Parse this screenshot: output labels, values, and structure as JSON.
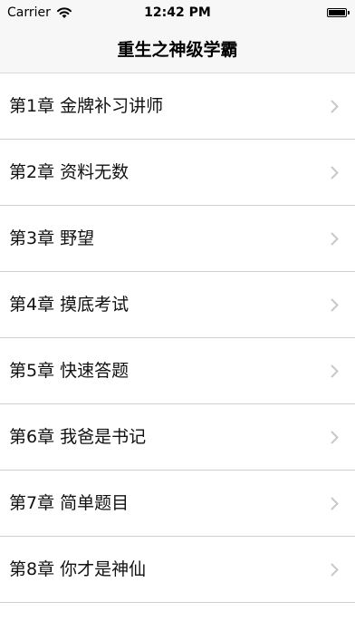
{
  "status_bar": {
    "carrier": "Carrier",
    "time": "12:42 PM"
  },
  "nav": {
    "title": "重生之神级学霸"
  },
  "chapters": [
    "第1章 金牌补习讲师",
    "第2章 资料无数",
    "第3章 野望",
    "第4章 摸底考试",
    "第5章 快速答题",
    "第6章 我爸是书记",
    "第7章 简单题目",
    "第8章 你才是神仙"
  ],
  "icons": {
    "wifi": "wifi-icon",
    "battery": "battery-icon",
    "chevron": "chevron-right-icon"
  },
  "colors": {
    "bar_background": "#f7f7f7",
    "separator": "#cfcfd4",
    "chevron": "#c7c7cc"
  }
}
